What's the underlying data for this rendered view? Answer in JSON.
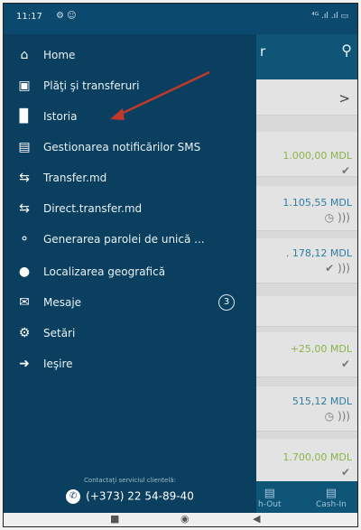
{
  "status": {
    "time": "11:17",
    "left_icons": "⚙ ☺",
    "right_icons": "⁴ᴳ .ıl .ıl ▭"
  },
  "background_app": {
    "header_partial": "r",
    "rows": [
      {
        "kind": "chevron",
        "chevron": ">"
      },
      {
        "kind": "amount",
        "amount": "1.000,00 MDL",
        "color": "green",
        "icons": "✔"
      },
      {
        "kind": "amount",
        "amount": "1.105,55 MDL",
        "color": "blue",
        "icons": "◷ ))) "
      },
      {
        "kind": "amount",
        "amount": ". 178,12 MDL",
        "color": "blue",
        "icons": "✔ )))"
      },
      {
        "kind": "blank"
      },
      {
        "kind": "amount",
        "amount": "+25,00 MDL",
        "color": "green",
        "icons": "✔"
      },
      {
        "kind": "amount",
        "amount": "515,12 MDL",
        "color": "blue",
        "icons": "◷ )))"
      },
      {
        "kind": "amount",
        "amount": "1.700,00 MDL",
        "color": "green",
        "icons": "✔"
      }
    ],
    "bottom_tabs": [
      {
        "label": "h-Out",
        "icon": "▤"
      },
      {
        "label": "Cash-In",
        "icon": "▤"
      }
    ]
  },
  "drawer": {
    "items": [
      {
        "label": "Home",
        "icon": "home-icon"
      },
      {
        "label": "Plăţi şi transferuri",
        "icon": "wallet-icon"
      },
      {
        "label": "Istoria",
        "icon": "history-icon"
      },
      {
        "label": "Gestionarea notificărilor SMS",
        "icon": "sms-icon"
      },
      {
        "label": "Transfer.md",
        "icon": "transfer-icon"
      },
      {
        "label": "Direct.transfer.md",
        "icon": "transfer-icon"
      },
      {
        "label": "Generarea parolei de unică ...",
        "icon": "key-icon"
      },
      {
        "label": "Localizarea geografică",
        "icon": "location-icon"
      },
      {
        "label": "Mesaje",
        "icon": "mail-icon",
        "badge": "3"
      },
      {
        "label": "Setări",
        "icon": "settings-icon"
      },
      {
        "label": "Ieşire",
        "icon": "logout-icon"
      }
    ],
    "contact_label": "Contactaţi serviciul clientelă:",
    "contact_phone": "(+373) 22 54-89-40"
  },
  "colors": {
    "drawer": "#0b3f5f",
    "header": "#0e5578",
    "annotation_arrow": "#c0392b"
  }
}
